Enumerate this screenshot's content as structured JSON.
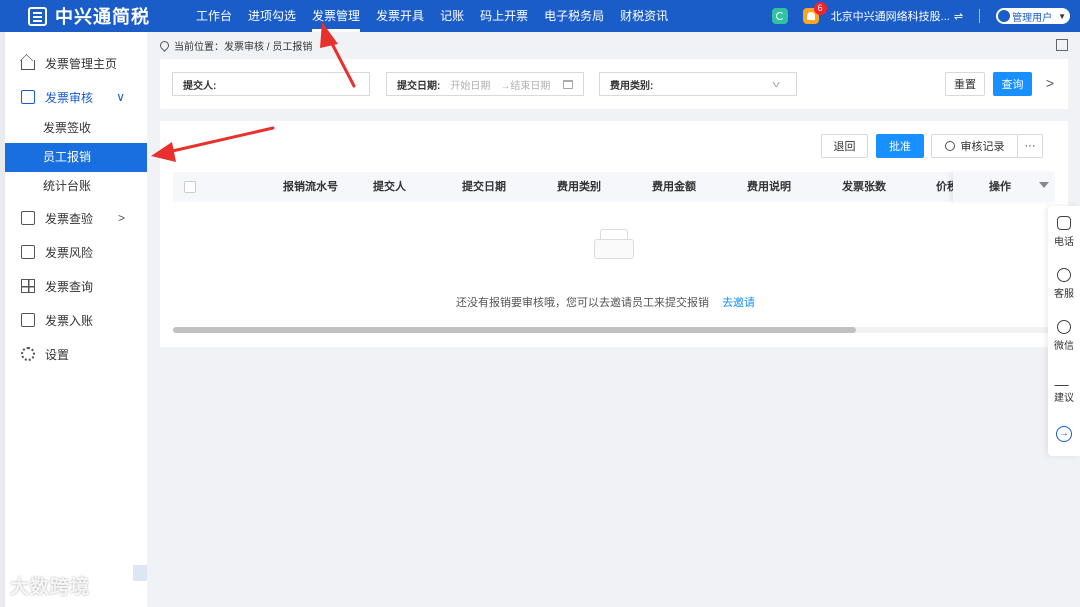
{
  "app": {
    "name": "中兴通简税"
  },
  "topnav": {
    "items": [
      {
        "label": "工作台",
        "active": false
      },
      {
        "label": "进项勾选",
        "active": false
      },
      {
        "label": "发票管理",
        "active": true
      },
      {
        "label": "发票开具",
        "active": false
      },
      {
        "label": "记账",
        "active": false
      },
      {
        "label": "码上开票",
        "active": false
      },
      {
        "label": "电子税务局",
        "active": false
      },
      {
        "label": "财税资讯",
        "active": false
      }
    ],
    "notification_count": "6",
    "company": "北京中兴通网络科技股...",
    "swap_glyph": "⇌",
    "user": "管理用户"
  },
  "sidebar": {
    "items": [
      {
        "label": "发票管理主页"
      },
      {
        "label": "发票审核"
      },
      {
        "label": "发票签收"
      },
      {
        "label": "员工报销"
      },
      {
        "label": "统计台账"
      },
      {
        "label": "发票查验"
      },
      {
        "label": "发票风险"
      },
      {
        "label": "发票查询"
      },
      {
        "label": "发票入账"
      },
      {
        "label": "设置"
      }
    ]
  },
  "breadcrumb": {
    "prefix": "当前位置：",
    "path": "发票审核 / 员工报销"
  },
  "filters": {
    "submitter_label": "提交人:",
    "date_label": "提交日期:",
    "date_start_placeholder": "开始日期",
    "date_end_placeholder": "→结束日期",
    "category_label": "费用类别:",
    "reset": "重置",
    "query": "查询"
  },
  "actions": {
    "return": "退回",
    "approve": "批准",
    "history": "审核记录",
    "more": "···"
  },
  "table": {
    "columns": [
      "报销流水号",
      "提交人",
      "提交日期",
      "费用类别",
      "费用金额",
      "费用说明",
      "发票张数",
      "价税",
      "操作"
    ],
    "empty_text": "还没有报销要审核哦，您可以去邀请员工来提交报销",
    "empty_link": "去邀请"
  },
  "rightbar": {
    "items": [
      "电话",
      "客服",
      "微信",
      "建议"
    ]
  },
  "watermark": "大数跨境",
  "colors": {
    "brand": "#1a5dc9",
    "primary": "#1890ff",
    "active_menu": "#1a6fe0",
    "annotation": "#e8312c"
  }
}
